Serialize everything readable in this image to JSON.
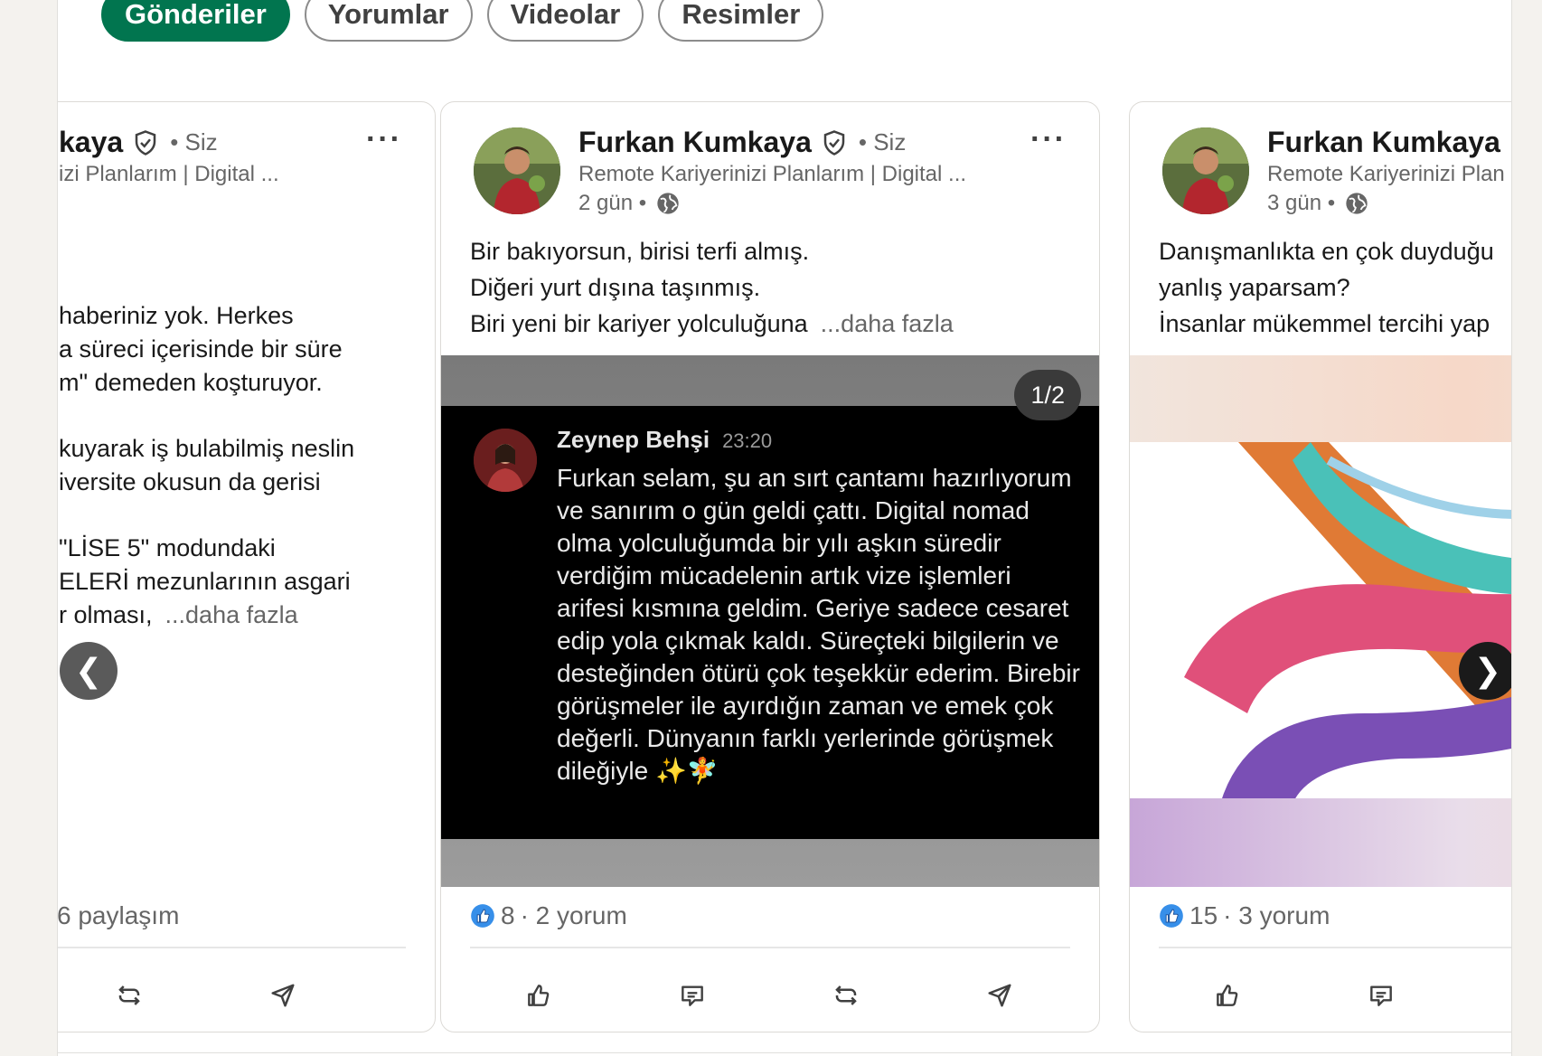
{
  "tabs": [
    {
      "label": "Gönderiler",
      "active": true
    },
    {
      "label": "Yorumlar",
      "active": false
    },
    {
      "label": "Videolar",
      "active": false
    },
    {
      "label": "Resimler",
      "active": false
    }
  ],
  "colors": {
    "accent": "#01754f",
    "like_blue": "#378fe9"
  },
  "posts": [
    {
      "author": "kaya",
      "relation": "• Siz",
      "headline": "izi Planlarım | Digital ...",
      "lines": [
        "haberiniz yok. Herkes",
        "a süreci içerisinde bir süre",
        "m\" demeden koşturuyor.",
        "",
        "kuyarak iş bulabilmiş neslin",
        "iversite okusun da gerisi",
        "",
        "\"LİSE 5\" modundaki",
        "ELERİ mezunlarının asgari"
      ],
      "last_line": "r olması,",
      "more": "...daha fazla",
      "stats": "6 paylaşım"
    },
    {
      "author": "Furkan Kumkaya",
      "relation": "• Siz",
      "headline": "Remote Kariyerinizi Planlarım | Digital ...",
      "time": "2 gün •",
      "lines": [
        "Bir bakıyorsun, birisi terfi almış.",
        "Diğeri yurt dışına taşınmış."
      ],
      "last_line": "Biri yeni bir kariyer yolculuğuna",
      "more": "...daha fazla",
      "counter": "1/2",
      "chat": {
        "name": "Zeynep Behşi",
        "time": "23:20",
        "message": "Furkan selam, şu an sırt çantamı hazırlıyorum ve sanırım o gün geldi çattı. Digital nomad olma yolculuğumda bir yılı aşkın süredir verdiğim mücadelenin artık vize işlemleri arifesi kısmına geldim. Geriye sadece cesaret edip yola çıkmak kaldı. Süreçteki bilgilerin ve desteğinden ötürü çok teşekkür ederim. Birebir görüşmeler ile ayırdığın zaman ve emek çok değerli. Dünyanın farklı yerlerinde görüşmek dileğiyle ✨🧚"
      },
      "reactions": "8",
      "comments": "· 2 yorum"
    },
    {
      "author": "Furkan Kumkaya",
      "headline": "Remote Kariyerinizi Plan",
      "time": "3 gün •",
      "lines": [
        "Danışmanlıkta en çok duyduğu",
        "yanlış yaparsam?",
        "İnsanlar mükemmel tercihi yap"
      ],
      "reactions": "15",
      "comments": "· 3 yorum"
    }
  ],
  "nav": {
    "prev": "❮",
    "next": "❯"
  },
  "more_menu": "···"
}
